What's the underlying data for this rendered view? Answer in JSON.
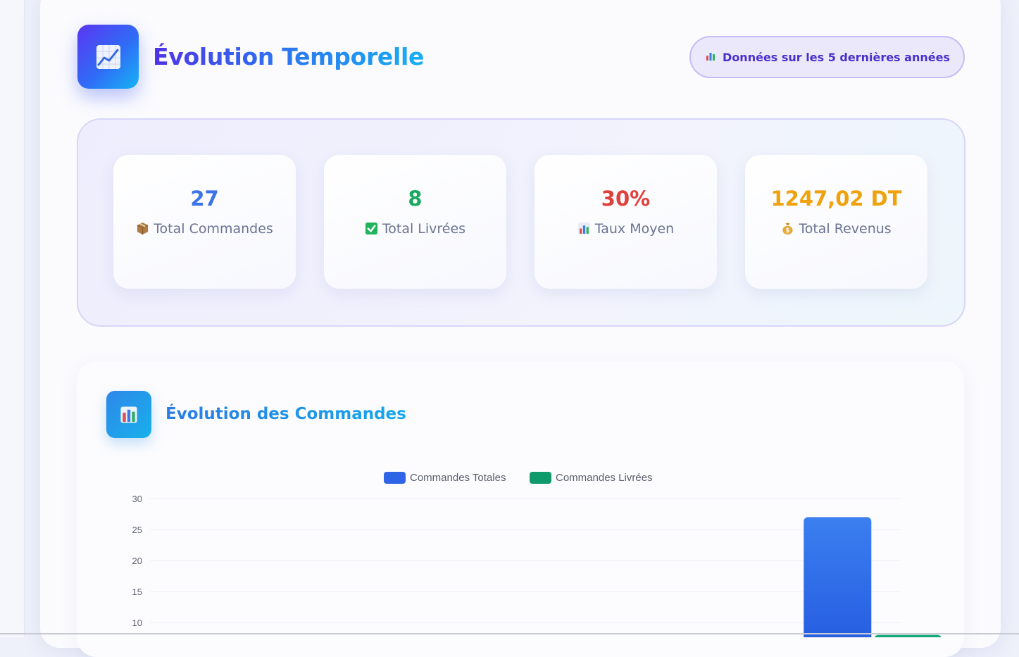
{
  "header": {
    "title": "Évolution Temporelle",
    "icon": "chart-increasing-icon",
    "badge": {
      "icon": "bar-chart-icon",
      "text": "Données sur les 5 dernières années"
    }
  },
  "stats": [
    {
      "value": "27",
      "label": "Total Commandes",
      "icon": "package-icon",
      "color": "#3b74e8"
    },
    {
      "value": "8",
      "label": "Total Livrées",
      "icon": "check-box-icon",
      "color": "#18a860"
    },
    {
      "value": "30%",
      "label": "Taux Moyen",
      "icon": "bar-chart-icon",
      "color": "#e0403c"
    },
    {
      "value": "1247,02 DT",
      "label": "Total Revenus",
      "icon": "money-bag-icon",
      "color": "#f0a20c"
    }
  ],
  "chart_section": {
    "title": "Évolution des Commandes",
    "icon": "bar-chart-icon"
  },
  "chart_data": {
    "type": "bar",
    "series": [
      {
        "name": "Commandes Totales",
        "color": "#2f64e6",
        "values": [
          0,
          0,
          0,
          0,
          27
        ]
      },
      {
        "name": "Commandes Livrées",
        "color": "#0e9a6a",
        "values": [
          0,
          0,
          0,
          0,
          8
        ]
      }
    ],
    "y_ticks": [
      "30",
      "25",
      "20",
      "15",
      "10"
    ],
    "ylim": [
      0,
      30
    ],
    "grid": true,
    "legend_position": "top-center"
  }
}
